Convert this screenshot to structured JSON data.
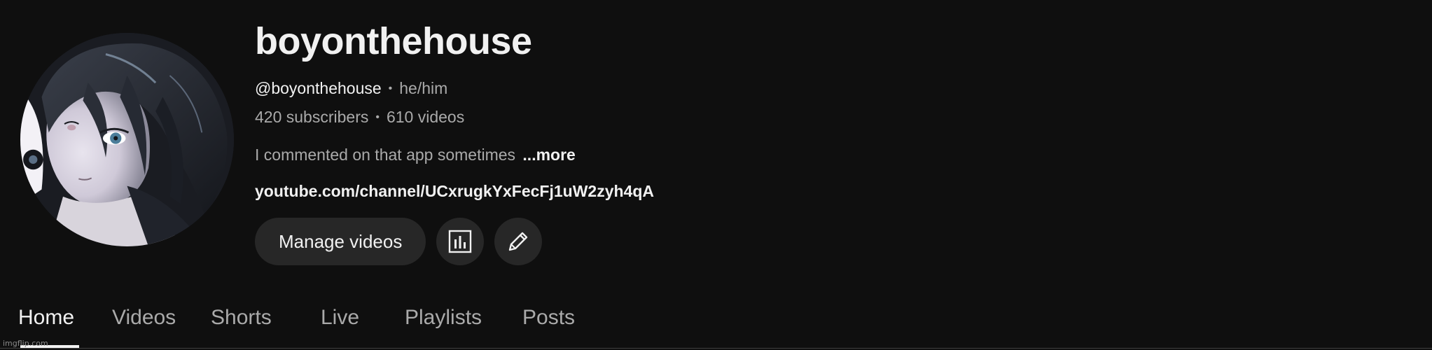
{
  "channel": {
    "name": "boyonthehouse",
    "handle": "@boyonthehouse",
    "pronouns": "he/him",
    "subscribers": "420 subscribers",
    "videos": "610 videos",
    "separator": "•",
    "description": "I commented on that app sometimes",
    "more_label": "...more",
    "link": "youtube.com/channel/UCxrugkYxFecFj1uW2zyh4qA"
  },
  "actions": {
    "manage_label": "Manage videos",
    "analytics_icon": "analytics-chart-icon",
    "edit_icon": "pencil-icon"
  },
  "tabs": [
    {
      "label": "Home",
      "active": true
    },
    {
      "label": "Videos",
      "active": false
    },
    {
      "label": "Shorts",
      "active": false
    },
    {
      "label": "Live",
      "active": false
    },
    {
      "label": "Playlists",
      "active": false
    },
    {
      "label": "Posts",
      "active": false
    }
  ],
  "watermark": "imgflip.com",
  "colors": {
    "background": "#0f0f0f",
    "primary_text": "#f1f1f1",
    "secondary_text": "#aaaaaa",
    "button_bg": "#272727"
  }
}
